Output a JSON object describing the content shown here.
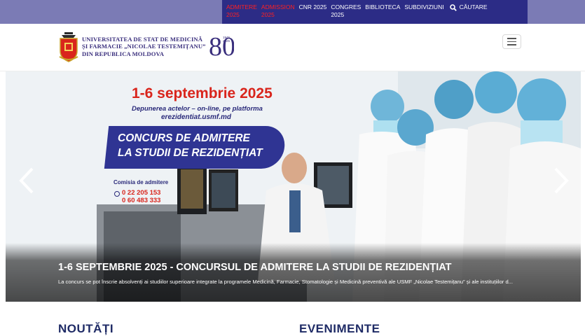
{
  "topnav": {
    "items": [
      {
        "label": "ADMITERE\n2025",
        "color": "#ff2020"
      },
      {
        "label": "ADMISSION\n2025",
        "color": "#ff2020"
      },
      {
        "label": "CNR 2025",
        "color": "#ffffff"
      },
      {
        "label": "CONGRES\n2025",
        "color": "#ffffff"
      },
      {
        "label": "BIBLIOTECA",
        "color": "#ffffff"
      },
      {
        "label": "SUBDIVIZIUNI",
        "color": "#ffffff"
      }
    ],
    "search_label": "CĂUTARE",
    "search_icon": "search-icon"
  },
  "header": {
    "logo_lines": [
      "UNIVERSITATEA DE STAT DE MEDICINĂ",
      "ȘI FARMACIE „NICOLAE TESTEMIȚANU”",
      "DIN REPUBLICA MOLDOVA"
    ],
    "badge_number": "80",
    "badge_years": "1945\n2025",
    "menu_icon": "hamburger-icon"
  },
  "hero": {
    "poster": {
      "date": "1-6 septembrie 2025",
      "subtitle": "Depunerea actelor – on-line, pe platforma",
      "url": "erezidentiat.usmf.md",
      "banner": "CONCURS DE ADMITERE\nLA STUDII DE REZIDENȚIAT",
      "commission": "Comisia de admitere",
      "phones": "0 22 205 153\n0 60 483 333"
    },
    "caption_title": "1-6 SEPTEMBRIE 2025 - CONCURSUL DE ADMITERE LA STUDII DE REZIDENȚIAT",
    "caption_text": "La concurs se pot înscrie absolvenți ai studiilor superioare integrate la programele Medicină, Farmacie, Stomatologie și Medicină preventivă ale USMF „Nicolae Testemițanu” și ale instituțiilor d...",
    "prev_icon": "chevron-left-icon",
    "next_icon": "chevron-right-icon"
  },
  "sections": {
    "news": "NOUTĂȚI",
    "events": "EVENIMENTE"
  },
  "colors": {
    "topbar": "#7b7bb5",
    "topnav": "#2c2c86",
    "accent_red": "#ff2020",
    "brand_blue": "#2f3493"
  }
}
